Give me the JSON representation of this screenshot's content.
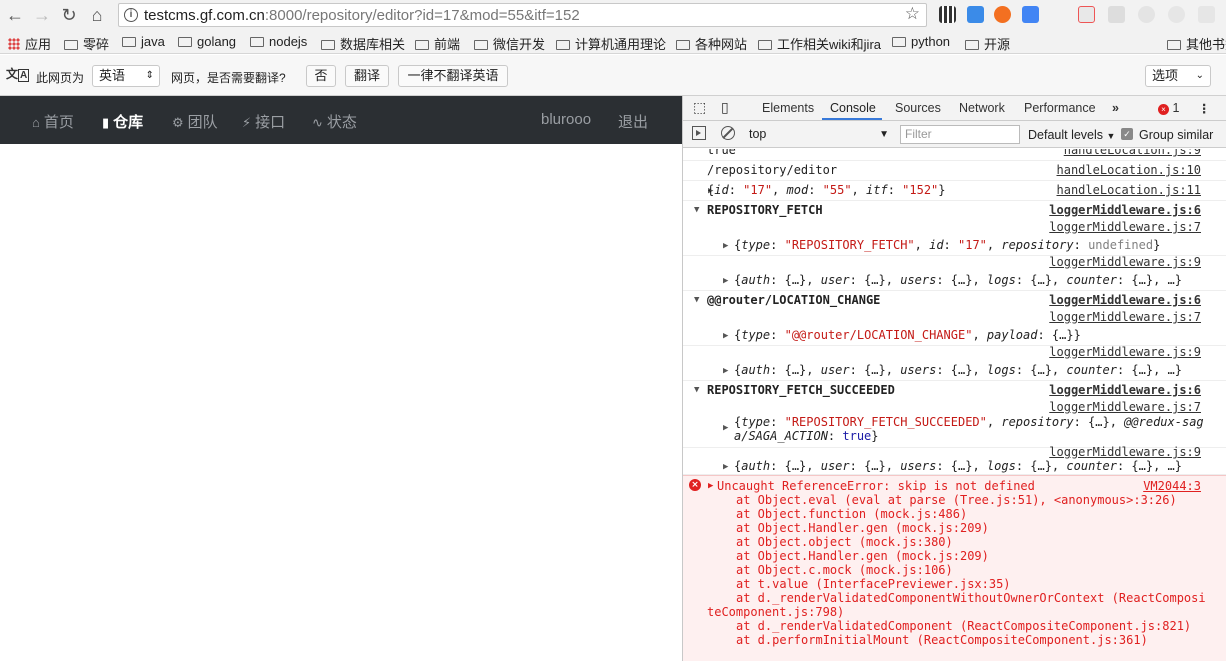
{
  "browser": {
    "url_host": "testcms.gf.com.cn",
    "url_rest": ":8000/repository/editor?id=17&mod=55&itf=152"
  },
  "bookmarks": [
    {
      "label": "应用"
    },
    {
      "label": "零碎"
    },
    {
      "label": "java"
    },
    {
      "label": "golang"
    },
    {
      "label": "nodejs"
    },
    {
      "label": "数据库相关"
    },
    {
      "label": "前端"
    },
    {
      "label": "微信开发"
    },
    {
      "label": "计算机通用理论"
    },
    {
      "label": "各种网站"
    },
    {
      "label": "工作相关wiki和jira"
    },
    {
      "label": "python"
    },
    {
      "label": "开源"
    },
    {
      "label": "其他书签"
    }
  ],
  "translate": {
    "page_is": "此网页为",
    "language": "英语",
    "question": "网页，是否需要翻译?",
    "no": "否",
    "translate": "翻译",
    "never": "一律不翻译英语",
    "options": "选项"
  },
  "appnav": {
    "home": "首页",
    "repo": "仓库",
    "team": "团队",
    "api": "接口",
    "status": "状态",
    "user": "blurooo",
    "logout": "退出"
  },
  "devtools": {
    "tabs": [
      "Elements",
      "Console",
      "Sources",
      "Network",
      "Performance"
    ],
    "error_count": "1",
    "context": "top",
    "filter_placeholder": "Filter",
    "levels": "Default levels",
    "group_similar": "Group similar"
  },
  "console": {
    "r0": {
      "msg": "true",
      "src": "handleLocation.js:9"
    },
    "r1": {
      "msg": "/repository/editor",
      "src": "handleLocation.js:10"
    },
    "r2": {
      "src": "handleLocation.js:11"
    },
    "g1": {
      "msg": "REPOSITORY_FETCH",
      "src": "loggerMiddleware.js:6",
      "src7": "loggerMiddleware.js:7",
      "src9": "loggerMiddleware.js:9"
    },
    "g2": {
      "msg": "@@router/LOCATION_CHANGE",
      "src": "loggerMiddleware.js:6",
      "src7": "loggerMiddleware.js:7",
      "src9": "loggerMiddleware.js:9"
    },
    "g3": {
      "msg": "REPOSITORY_FETCH_SUCCEEDED",
      "src": "loggerMiddleware.js:6",
      "src7": "loggerMiddleware.js:7",
      "src9": "loggerMiddleware.js:9"
    },
    "error": {
      "title": "Uncaught ReferenceError: skip is not defined",
      "src": "VM2044:3",
      "stack": [
        "at Object.eval (eval at parse (Tree.js:51), <anonymous>:3:26)",
        "at Object.function (mock.js:486)",
        "at Object.Handler.gen (mock.js:209)",
        "at Object.object (mock.js:380)",
        "at Object.Handler.gen (mock.js:209)",
        "at Object.c.mock (mock.js:106)",
        "at t.value (InterfacePreviewer.jsx:35)",
        "at d._renderValidatedComponentWithoutOwnerOrContext (ReactComposi",
        "teComponent.js:798)",
        "at d._renderValidatedComponent (ReactCompositeComponent.js:821)",
        "at d.performInitialMount (ReactCompositeComponent.js:361)"
      ]
    }
  }
}
